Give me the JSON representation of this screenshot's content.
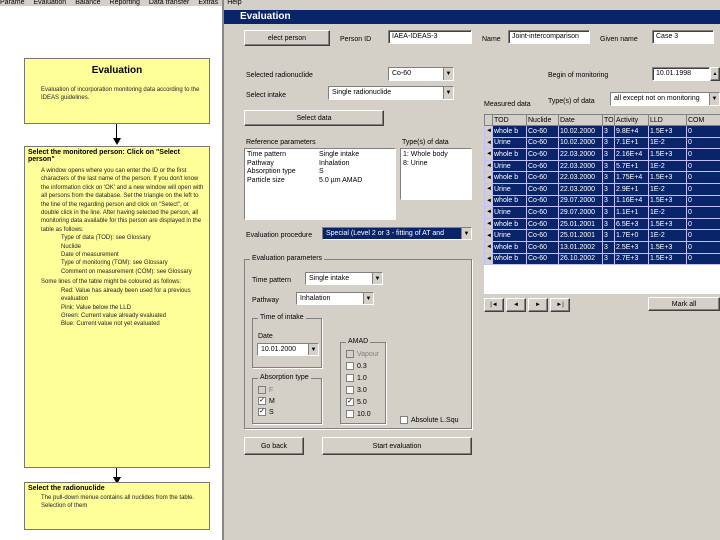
{
  "menu": [
    "Parame",
    "Evaluation",
    "Balance",
    "Reporting",
    "Data transfer",
    "Extras",
    "Help"
  ],
  "help": {
    "panel1": {
      "title": "Evaluation",
      "text": "Evaluation of incorporation monitoring data according to the IDEAS guidelines."
    },
    "panel2": {
      "title": "Select the monitored person: Click on \"Select person\"",
      "text": "A window opens where you can enter the ID or the first characters of the last name of the person. If you don't know the information click on 'OK' and a new window will open with all persons from the database. Set the triangle on the left to the line of the regarding person and click on \"Select\", or double click in the line. After having selected the person, all monitoring data available for this person are displayed in the table as follows:",
      "items": [
        "Type of data (TOD): see Glossary",
        "Nuclide",
        "Date of measurement",
        "Type of monitoring (TOM): see Glossary",
        "Comment on measurement (COM): see Glossary"
      ],
      "text2": "Some lines of the table might be coloured as follows:",
      "colors": [
        "Red: Value has already been used for a previous evaluation",
        "Pink: Value below the LLD",
        "Green: Current value already evaluated",
        "Blue: Current value not yet evaluated"
      ]
    },
    "panel3": {
      "title": "Select the radionuclide",
      "text": "The pull-down menue contains all nuclides from the table. Selection of them"
    }
  },
  "window": {
    "title": "Evaluation"
  },
  "person": {
    "select_button": "elect person",
    "id_label": "Person ID",
    "id_value": "IAEA-IDEAS-3",
    "name_label": "Name",
    "name_value": "Joint-intercomparison",
    "given_label": "Given name",
    "given_value": "Case 3"
  },
  "nuclide": {
    "label": "Selected radionuclide",
    "value": "Co-60"
  },
  "intake": {
    "label": "Select intake",
    "value": "Single radionuclide"
  },
  "select_data_button": "Select data",
  "begin_monitoring": {
    "label": "Begin of monitoring",
    "value": "10.01.1998"
  },
  "measured_label": "Measured data",
  "type_of_data": {
    "label": "Type(s) of data",
    "value": "all except not on monitoring"
  },
  "reference": {
    "title": "Reference parameters",
    "rows": [
      [
        "Time pattern",
        "Single intake"
      ],
      [
        "Pathway",
        "Inhalation"
      ],
      [
        "Absorption type",
        "S"
      ],
      [
        "Particle size",
        "5.0 µm AMAD"
      ]
    ]
  },
  "types_of_data": {
    "title": "Type(s) of data",
    "items": [
      "1: Whole body",
      "8: Urine"
    ]
  },
  "procedure": {
    "label": "Evaluation procedure",
    "value": "Special (Level 2 or 3 - fitting of AT and"
  },
  "params": {
    "title": "Evaluation parameters",
    "time_label": "Time pattern",
    "time_value": "Single intake",
    "path_label": "Pathway",
    "path_value": "Inhalation",
    "tintake_title": "Time of intake",
    "date_label": "Date",
    "date_value": "10.01.2000",
    "abs_title": "Absorption type",
    "abs": [
      {
        "label": "F",
        "checked": false,
        "disabled": true
      },
      {
        "label": "M",
        "checked": true,
        "disabled": false
      },
      {
        "label": "S",
        "checked": true,
        "disabled": false
      }
    ],
    "amad_title": "AMAD",
    "amad": [
      {
        "label": "Vapour",
        "checked": false,
        "disabled": true
      },
      {
        "label": "0.3",
        "checked": false,
        "disabled": false
      },
      {
        "label": "1.0",
        "checked": false,
        "disabled": false
      },
      {
        "label": "3.0",
        "checked": false,
        "disabled": false
      },
      {
        "label": "5.0",
        "checked": true,
        "disabled": false
      },
      {
        "label": "10.0",
        "checked": false,
        "disabled": false
      }
    ],
    "absolute_label": "Absolute L.Squ"
  },
  "go_back": "Go back",
  "start_eval": "Start evaluation",
  "table": {
    "columns": [
      "TOD",
      "Nuclide",
      "Date",
      "TO",
      "Activity",
      "LLD",
      "COM"
    ],
    "rows": [
      [
        "whole b",
        "Co-60",
        "10.02.2000",
        "3",
        "9.8E+4",
        "1.5E+3",
        "0"
      ],
      [
        "Urine",
        "Co-60",
        "10.02.2000",
        "3",
        "7.1E+1",
        "1E-2",
        "0"
      ],
      [
        "whole b",
        "Co-60",
        "22.03.2000",
        "3",
        "2.16E+4",
        "1.5E+3",
        "0"
      ],
      [
        "Urine",
        "Co-60",
        "22.03.2000",
        "3",
        "5.7E+1",
        "1E-2",
        "0"
      ],
      [
        "whole b",
        "Co-60",
        "22.03.2000",
        "3",
        "1.75E+4",
        "1.5E+3",
        "0"
      ],
      [
        "Urine",
        "Co-60",
        "22.03.2000",
        "3",
        "2.9E+1",
        "1E-2",
        "0"
      ],
      [
        "whole b",
        "Co-60",
        "29.07.2000",
        "3",
        "1.16E+4",
        "1.5E+3",
        "0"
      ],
      [
        "Urine",
        "Co-60",
        "29.07.2000",
        "3",
        "1.1E+1",
        "1E-2",
        "0"
      ],
      [
        "whole b",
        "Co-60",
        "25.01.2001",
        "3",
        "6.5E+3",
        "1.5E+3",
        "0"
      ],
      [
        "Urine",
        "Co-60",
        "25.01.2001",
        "3",
        "1.7E+0",
        "1E-2",
        "0"
      ],
      [
        "whole b",
        "Co-60",
        "13.01.2002",
        "3",
        "2.5E+3",
        "1.5E+3",
        "0"
      ],
      [
        "whole b",
        "Co-60",
        "26.10.2002",
        "3",
        "2.7E+3",
        "1.5E+3",
        "0"
      ]
    ]
  },
  "nav": [
    "|◄",
    "◄",
    "►",
    "►|"
  ],
  "mark_all": "Mark all"
}
